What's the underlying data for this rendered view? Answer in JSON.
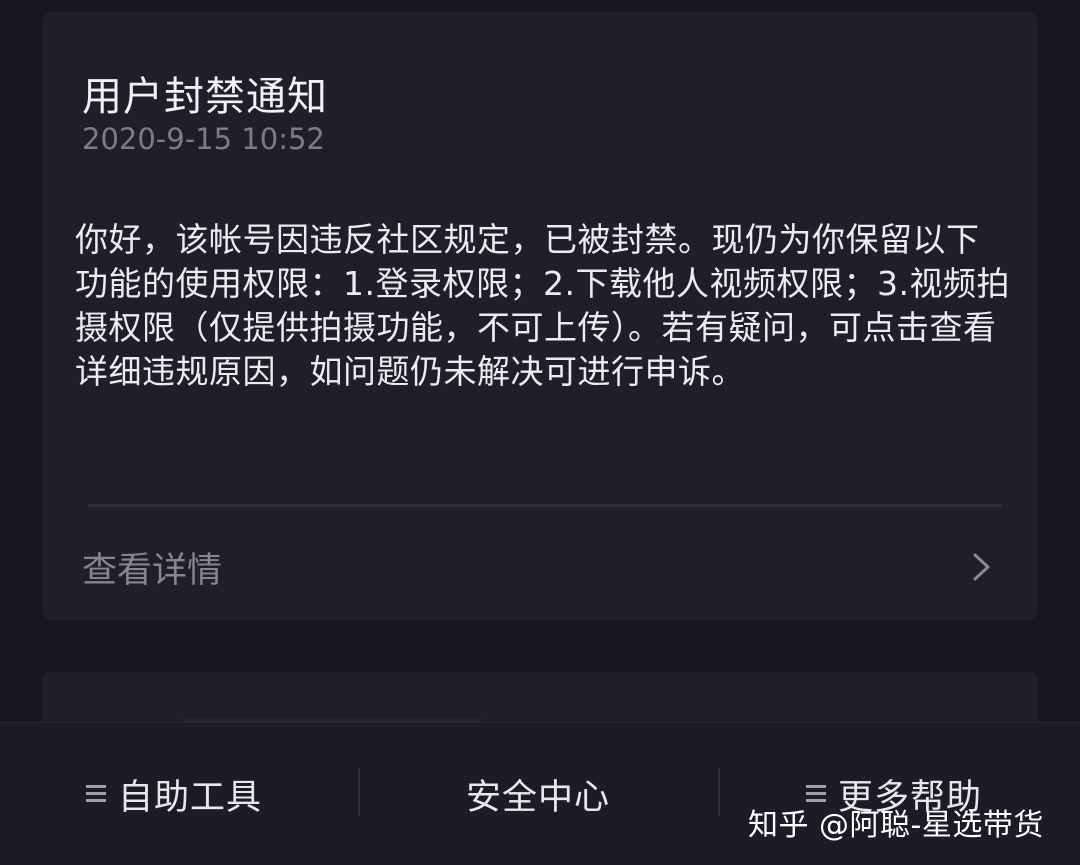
{
  "notice": {
    "title": "用户封禁通知",
    "timestamp": "2020-9-15 10:52",
    "body": "你好，该帐号因违反社区规定，已被封禁。现仍为你保留以下功能的使用权限：1.登录权限；2.下载他人视频权限；3.视频拍摄权限（仅提供拍摄功能，不可上传）。若有疑问，可点击查看详细违规原因，如问题仍未解决可进行申诉。",
    "detail_label": "查看详情"
  },
  "bottom_bar": {
    "tabs": [
      {
        "label": "自助工具",
        "icon": "menu-icon"
      },
      {
        "label": "安全中心"
      },
      {
        "label": "更多帮助",
        "icon": "menu-icon"
      }
    ]
  },
  "watermark": "知乎 @阿聪-星选带货",
  "colors": {
    "background": "#15161e",
    "card": "#1e1f29",
    "text_primary": "#ececf0",
    "text_secondary": "#7b7c86"
  }
}
